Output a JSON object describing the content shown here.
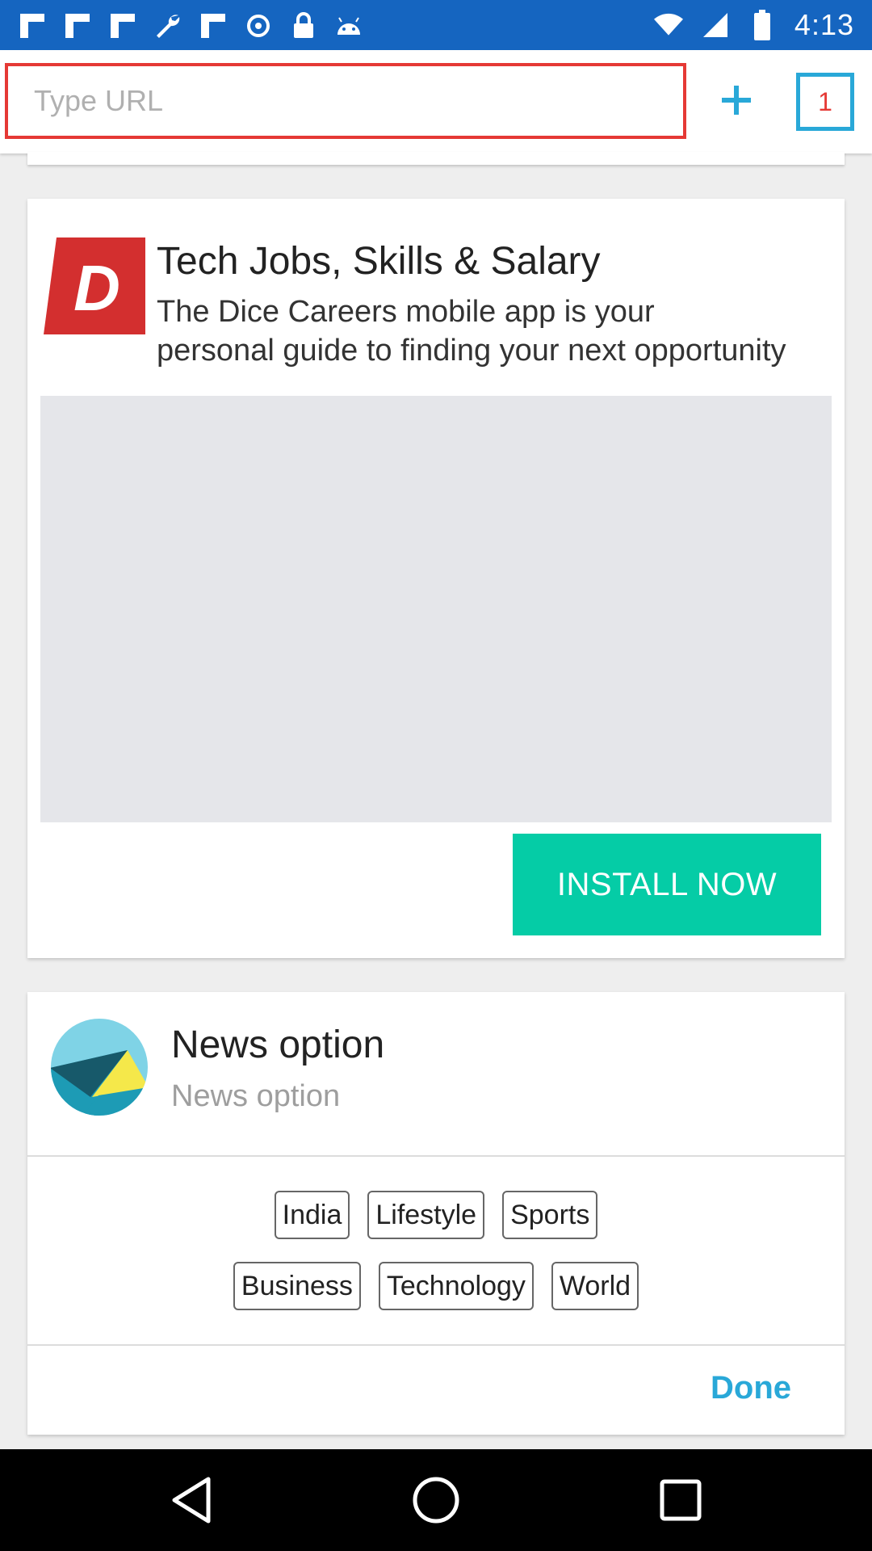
{
  "status_bar": {
    "time": "4:13",
    "left_icons": [
      "flipboard-icon",
      "flipboard-icon",
      "flipboard-icon",
      "wrench-icon",
      "flipboard-icon",
      "data-saver-icon",
      "lock-icon",
      "android-icon"
    ],
    "right_icons": [
      "wifi-icon",
      "signal-icon",
      "battery-icon"
    ]
  },
  "url_bar": {
    "placeholder": "Type URL",
    "tab_count": "1"
  },
  "ad": {
    "title": "Tech Jobs, Skills & Salary",
    "description_line1": "The Dice Careers mobile app is your",
    "description_line2": "personal guide to finding your next opportunity",
    "logo_letter": "D",
    "install_label": "INSTALL NOW"
  },
  "news": {
    "title": "News option",
    "subtitle": "News option",
    "chips_row1": [
      "India",
      "Lifestyle",
      "Sports"
    ],
    "chips_row2": [
      "Business",
      "Technology",
      "World"
    ],
    "done_label": "Done"
  },
  "colors": {
    "status_bar": "#1565c0",
    "url_border": "#e53935",
    "accent": "#29a8d8",
    "install": "#05cca6",
    "dice_red": "#d32f2f"
  }
}
